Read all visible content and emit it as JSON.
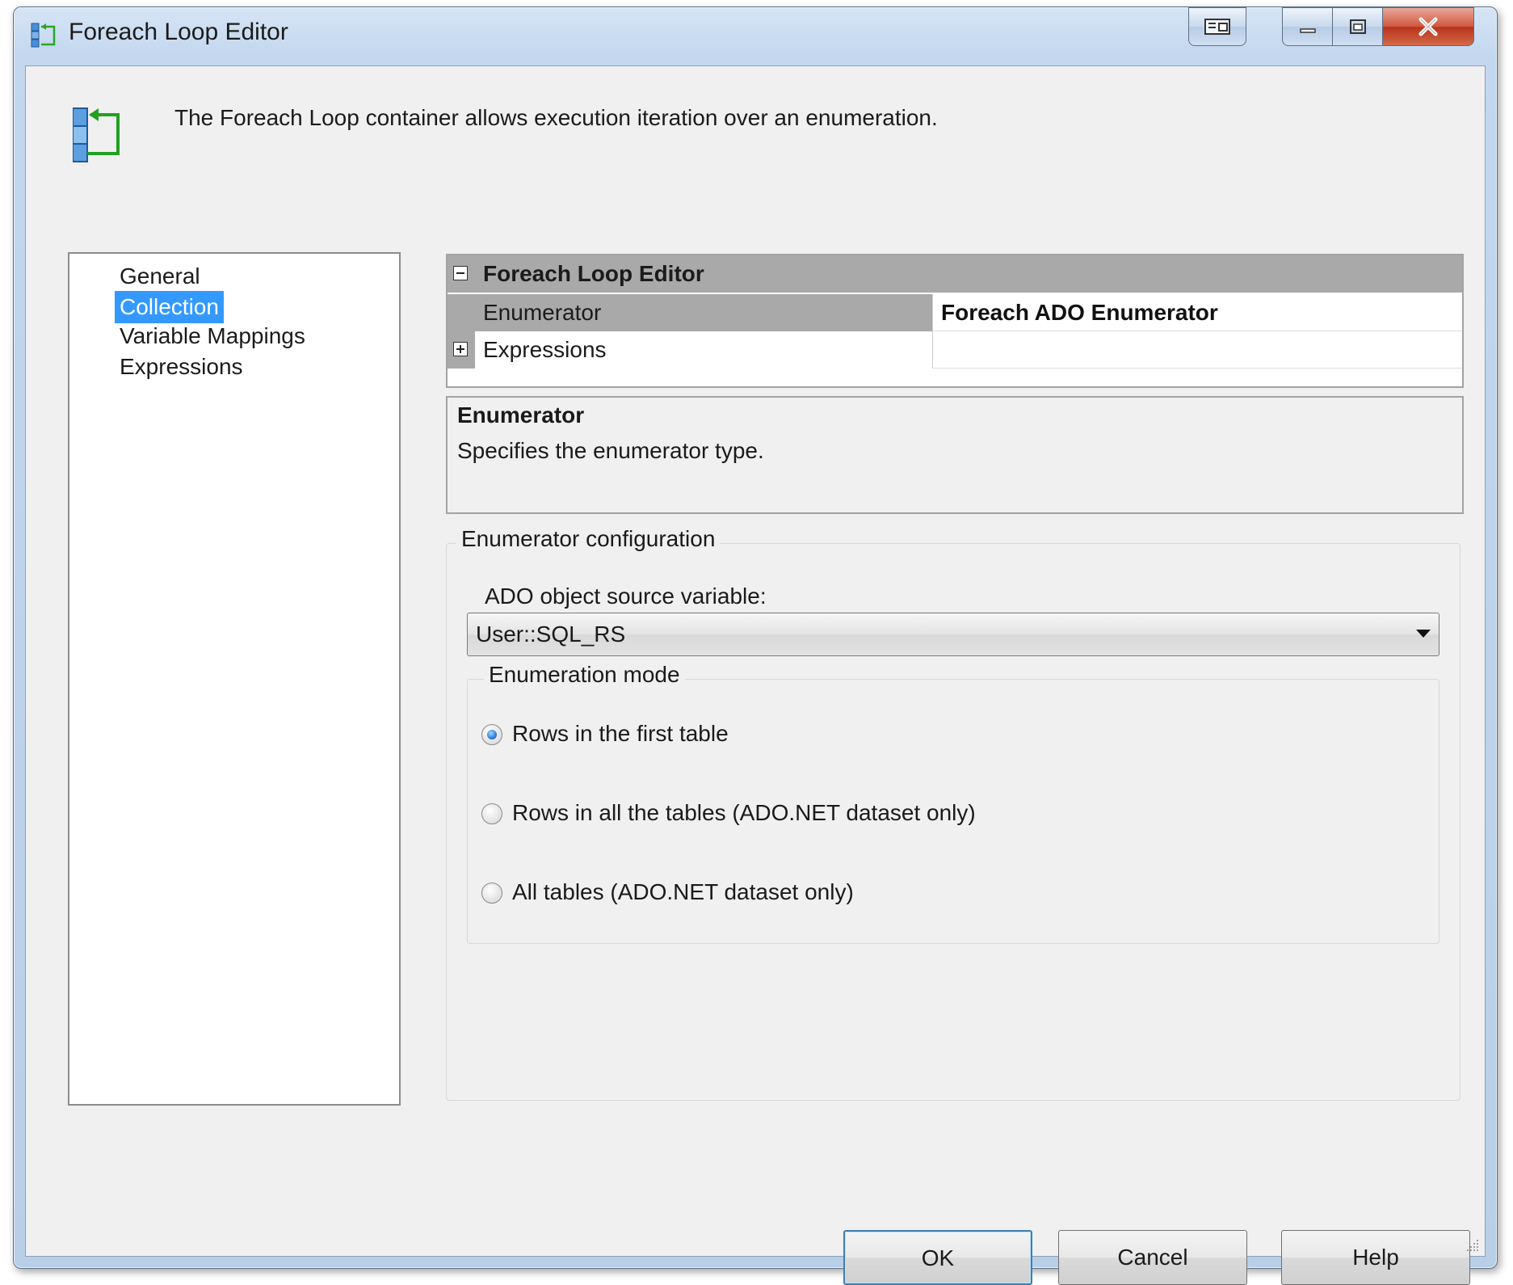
{
  "window": {
    "title": "Foreach Loop Editor",
    "icon": "foreach-loop-icon"
  },
  "header": {
    "description": "The Foreach Loop container allows execution iteration over an enumeration.",
    "icon": "foreach-loop-container-icon"
  },
  "nav": {
    "items": [
      {
        "label": "General",
        "selected": false
      },
      {
        "label": "Collection",
        "selected": true
      },
      {
        "label": "Variable Mappings",
        "selected": false
      },
      {
        "label": "Expressions",
        "selected": false
      }
    ]
  },
  "property_grid": {
    "category": "Foreach Loop Editor",
    "rows": [
      {
        "name": "Enumerator",
        "value": "Foreach ADO Enumerator"
      },
      {
        "name": "Expressions",
        "value": ""
      }
    ]
  },
  "description_panel": {
    "title": "Enumerator",
    "text": "Specifies the enumerator type."
  },
  "enumerator_config": {
    "legend": "Enumerator configuration",
    "source_label": "ADO object source variable:",
    "source_value": "User::SQL_RS",
    "mode_legend": "Enumeration mode",
    "modes": [
      {
        "label": "Rows in the first table",
        "checked": true
      },
      {
        "label": "Rows in all the tables (ADO.NET dataset only)",
        "checked": false
      },
      {
        "label": "All tables (ADO.NET dataset only)",
        "checked": false
      }
    ]
  },
  "buttons": {
    "ok": "OK",
    "cancel": "Cancel",
    "help": "Help"
  },
  "colors": {
    "selection": "#3399ff",
    "dialog_background": "#f0f0f0",
    "grid_header": "#a9a9a9"
  }
}
